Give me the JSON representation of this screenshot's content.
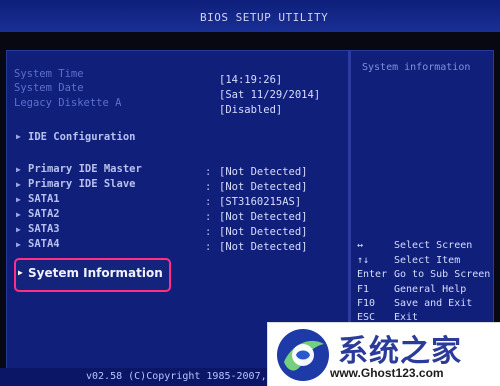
{
  "header": {
    "title": "BIOS SETUP UTILITY"
  },
  "system": {
    "time_label": "System Time",
    "time_value": "[14:19:26]",
    "date_label": "System Date",
    "date_value": "[Sat 11/29/2014]",
    "legacy_label": "Legacy Diskette A",
    "legacy_value": "[Disabled]"
  },
  "menu": {
    "ide_config_label": "IDE Configuration",
    "items": [
      {
        "label": "Primary IDE Master",
        "value": "[Not Detected]"
      },
      {
        "label": "Primary IDE Slave",
        "value": "[Not Detected]"
      },
      {
        "label": "SATA1",
        "value": "[ST3160215AS]"
      },
      {
        "label": "SATA2",
        "value": "[Not Detected]"
      },
      {
        "label": "SATA3",
        "value": "[Not Detected]"
      },
      {
        "label": "SATA4",
        "value": "[Not Detected]"
      }
    ],
    "selected_label": "Syetem Information"
  },
  "help": {
    "title": "System information"
  },
  "keys": [
    {
      "key": "↔",
      "desc": "Select Screen"
    },
    {
      "key": "↑↓",
      "desc": "Select Item"
    },
    {
      "key": "Enter",
      "desc": "Go to Sub Screen"
    },
    {
      "key": "F1",
      "desc": "General Help"
    },
    {
      "key": "F10",
      "desc": "Save and Exit"
    },
    {
      "key": "ESC",
      "desc": "Exit"
    }
  ],
  "footer": {
    "text": "v02.58 (C)Copyright 1985-2007,"
  },
  "watermark": {
    "title": "系统之家",
    "url": "www.Ghost123.com"
  },
  "colors": {
    "selection_border": "#ff2e86",
    "panel_bg": "#10207a"
  }
}
